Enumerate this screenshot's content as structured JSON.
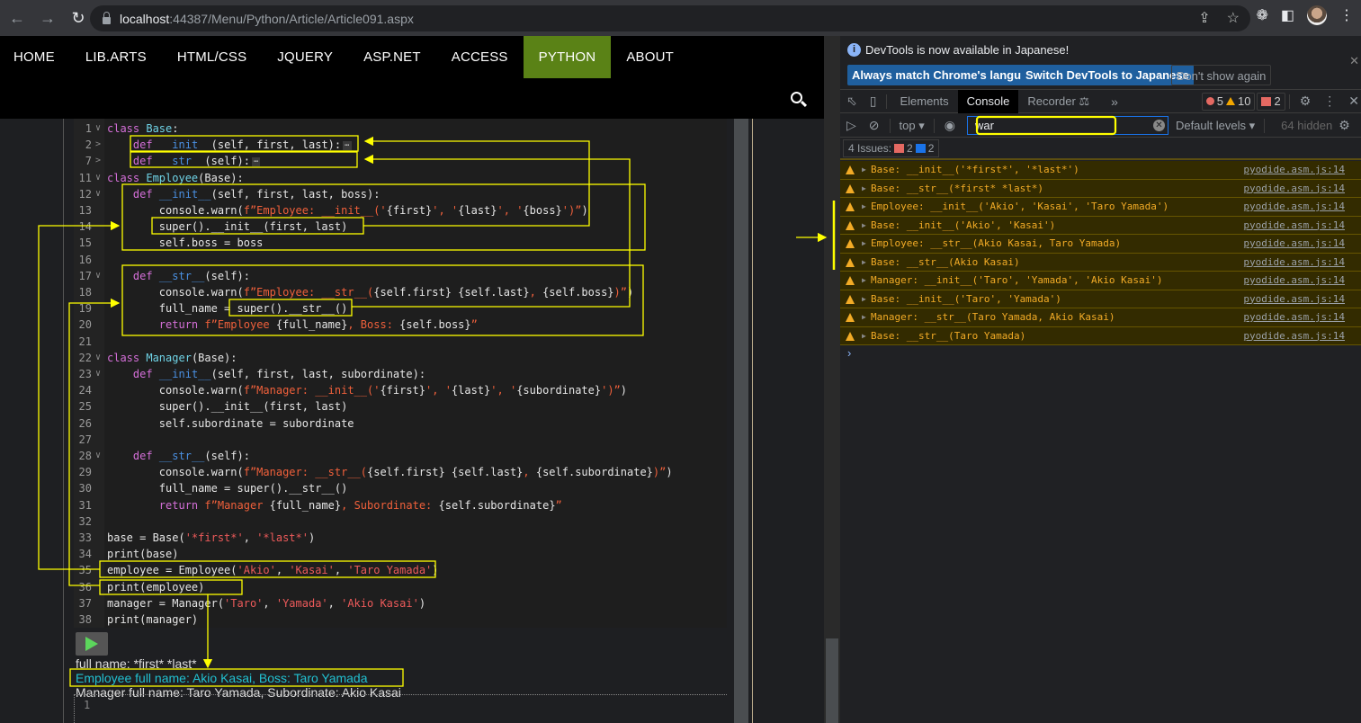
{
  "browser": {
    "url_host": "localhost",
    "url_path": ":44387/Menu/Python/Article/Article091.aspx",
    "icons": [
      "back-icon",
      "forward-icon",
      "reload-icon",
      "lock-icon",
      "share-icon",
      "star-icon",
      "extensions-icon",
      "sidebar-icon",
      "avatar",
      "menu-icon"
    ]
  },
  "site": {
    "nav": [
      {
        "label": "HOME"
      },
      {
        "label": "LIB.ARTS"
      },
      {
        "label": "HTML/CSS"
      },
      {
        "label": "JQUERY"
      },
      {
        "label": "ASP.NET"
      },
      {
        "label": "ACCESS"
      },
      {
        "label": "PYTHON",
        "active": true
      },
      {
        "label": "ABOUT"
      }
    ],
    "accent_color": "#5a8216"
  },
  "editor": {
    "lines": [
      {
        "n": "1",
        "fold": "v",
        "html": "<span class='kw'>class</span> <span class='cls'>Base</span>:"
      },
      {
        "n": "2",
        "fold": ">",
        "html": "    <span class='kw'>def</span> <span class='fn'>__init__</span>(self, first, last):<span class='ellipsis'>⋯</span>"
      },
      {
        "n": "7",
        "fold": ">",
        "html": "    <span class='kw'>def</span> <span class='fn'>__str__</span>(self):<span class='ellipsis'>⋯</span>"
      },
      {
        "n": "11",
        "fold": "v",
        "html": "<span class='kw'>class</span> <span class='cls'>Employee</span>(Base):"
      },
      {
        "n": "12",
        "fold": "v",
        "html": "    <span class='kw'>def</span> <span class='fn'>__init__</span>(self, first, last, boss):"
      },
      {
        "n": "13",
        "fold": "",
        "html": "        console.warn(<span class='str'>f”Employee: __init__('</span>{first}<span class='str'>', '</span>{last}<span class='str'>', '</span>{boss}<span class='str'>')”</span>)"
      },
      {
        "n": "14",
        "fold": "",
        "html": "        super().__init__(first, last)"
      },
      {
        "n": "15",
        "fold": "",
        "html": "        self.boss = boss"
      },
      {
        "n": "16",
        "fold": "",
        "html": ""
      },
      {
        "n": "17",
        "fold": "v",
        "html": "    <span class='kw'>def</span> <span class='fn'>__str__</span>(self):"
      },
      {
        "n": "18",
        "fold": "",
        "html": "        console.warn(<span class='str'>f”Employee: __str__(</span>{self.first} {self.last}<span class='str'>, </span>{self.boss}<span class='str'>)”</span>)"
      },
      {
        "n": "19",
        "fold": "",
        "html": "        full_name = super().__str__()"
      },
      {
        "n": "20",
        "fold": "",
        "html": "        <span class='kw'>return</span> <span class='str'>f”Employee </span>{full_name}<span class='str'>, Boss: </span>{self.boss}<span class='str'>”</span>"
      },
      {
        "n": "21",
        "fold": "",
        "html": ""
      },
      {
        "n": "22",
        "fold": "v",
        "html": "<span class='kw'>class</span> <span class='cls'>Manager</span>(Base):"
      },
      {
        "n": "23",
        "fold": "v",
        "html": "    <span class='kw'>def</span> <span class='fn'>__init__</span>(self, first, last, subordinate):"
      },
      {
        "n": "24",
        "fold": "",
        "html": "        console.warn(<span class='str'>f”Manager: __init__('</span>{first}<span class='str'>', '</span>{last}<span class='str'>', '</span>{subordinate}<span class='str'>')”</span>)"
      },
      {
        "n": "25",
        "fold": "",
        "html": "        super().__init__(first, last)"
      },
      {
        "n": "26",
        "fold": "",
        "html": "        self.subordinate = subordinate"
      },
      {
        "n": "27",
        "fold": "",
        "html": ""
      },
      {
        "n": "28",
        "fold": "v",
        "html": "    <span class='kw'>def</span> <span class='fn'>__str__</span>(self):"
      },
      {
        "n": "29",
        "fold": "",
        "html": "        console.warn(<span class='str'>f”Manager: __str__(</span>{self.first} {self.last}<span class='str'>, </span>{self.subordinate}<span class='str'>)”</span>)"
      },
      {
        "n": "30",
        "fold": "",
        "html": "        full_name = super().__str__()"
      },
      {
        "n": "31",
        "fold": "",
        "html": "        <span class='kw'>return</span> <span class='str'>f”Manager </span>{full_name}<span class='str'>, Subordinate: </span>{self.subordinate}<span class='str'>”</span>"
      },
      {
        "n": "32",
        "fold": "",
        "html": ""
      },
      {
        "n": "33",
        "fold": "",
        "html": "base = Base(<span class='q'>'*first*'</span>, <span class='q'>'*last*'</span>)"
      },
      {
        "n": "34",
        "fold": "",
        "html": "print(base)"
      },
      {
        "n": "35",
        "fold": "",
        "html": "employee = Employee(<span class='q'>'Akio'</span>, <span class='q'>'Kasai'</span>, <span class='q'>'Taro Yamada'</span>)"
      },
      {
        "n": "36",
        "fold": "",
        "html": "print(employee)"
      },
      {
        "n": "37",
        "fold": "",
        "html": "manager = Manager(<span class='q'>'Taro'</span>, <span class='q'>'Yamada'</span>, <span class='q'>'Akio Kasai'</span>)"
      },
      {
        "n": "38",
        "fold": "",
        "html": "print(manager)"
      }
    ],
    "output": [
      "full name: *first* *last*",
      "Employee full name: Akio Kasai, Boss: Taro Yamada",
      "Manager full name: Taro Yamada, Subordinate: Akio Kasai"
    ],
    "repl_line": "1"
  },
  "devtools": {
    "info_text": "DevTools is now available in Japanese!",
    "info_buttons": [
      "Always match Chrome's language",
      "Switch DevTools to Japanese",
      "Don't show again"
    ],
    "tabs": [
      "Elements",
      "Console",
      "Recorder"
    ],
    "active_tab": "Console",
    "counts": {
      "errors": "5",
      "warnings": "10",
      "issues": "2"
    },
    "context": "top",
    "filter_value": "war",
    "levels": "Default levels",
    "hidden": "64 hidden",
    "issues_label": "4 Issues:",
    "issues_red": "2",
    "issues_blue": "2",
    "messages": [
      {
        "text": "Base: __init__('*first*', '*last*')",
        "source": "pyodide.asm.js:14"
      },
      {
        "text": "Base: __str__(*first* *last*)",
        "source": "pyodide.asm.js:14"
      },
      {
        "text": "Employee: __init__('Akio', 'Kasai', 'Taro Yamada')",
        "source": "pyodide.asm.js:14"
      },
      {
        "text": "Base: __init__('Akio', 'Kasai')",
        "source": "pyodide.asm.js:14"
      },
      {
        "text": "Employee: __str__(Akio Kasai, Taro Yamada)",
        "source": "pyodide.asm.js:14"
      },
      {
        "text": "Base: __str__(Akio Kasai)",
        "source": "pyodide.asm.js:14"
      },
      {
        "text": "Manager: __init__('Taro', 'Yamada', 'Akio Kasai')",
        "source": "pyodide.asm.js:14"
      },
      {
        "text": "Base: __init__('Taro', 'Yamada')",
        "source": "pyodide.asm.js:14"
      },
      {
        "text": "Manager: __str__(Taro Yamada, Akio Kasai)",
        "source": "pyodide.asm.js:14"
      },
      {
        "text": "Base: __str__(Taro Yamada)",
        "source": "pyodide.asm.js:14"
      }
    ]
  }
}
